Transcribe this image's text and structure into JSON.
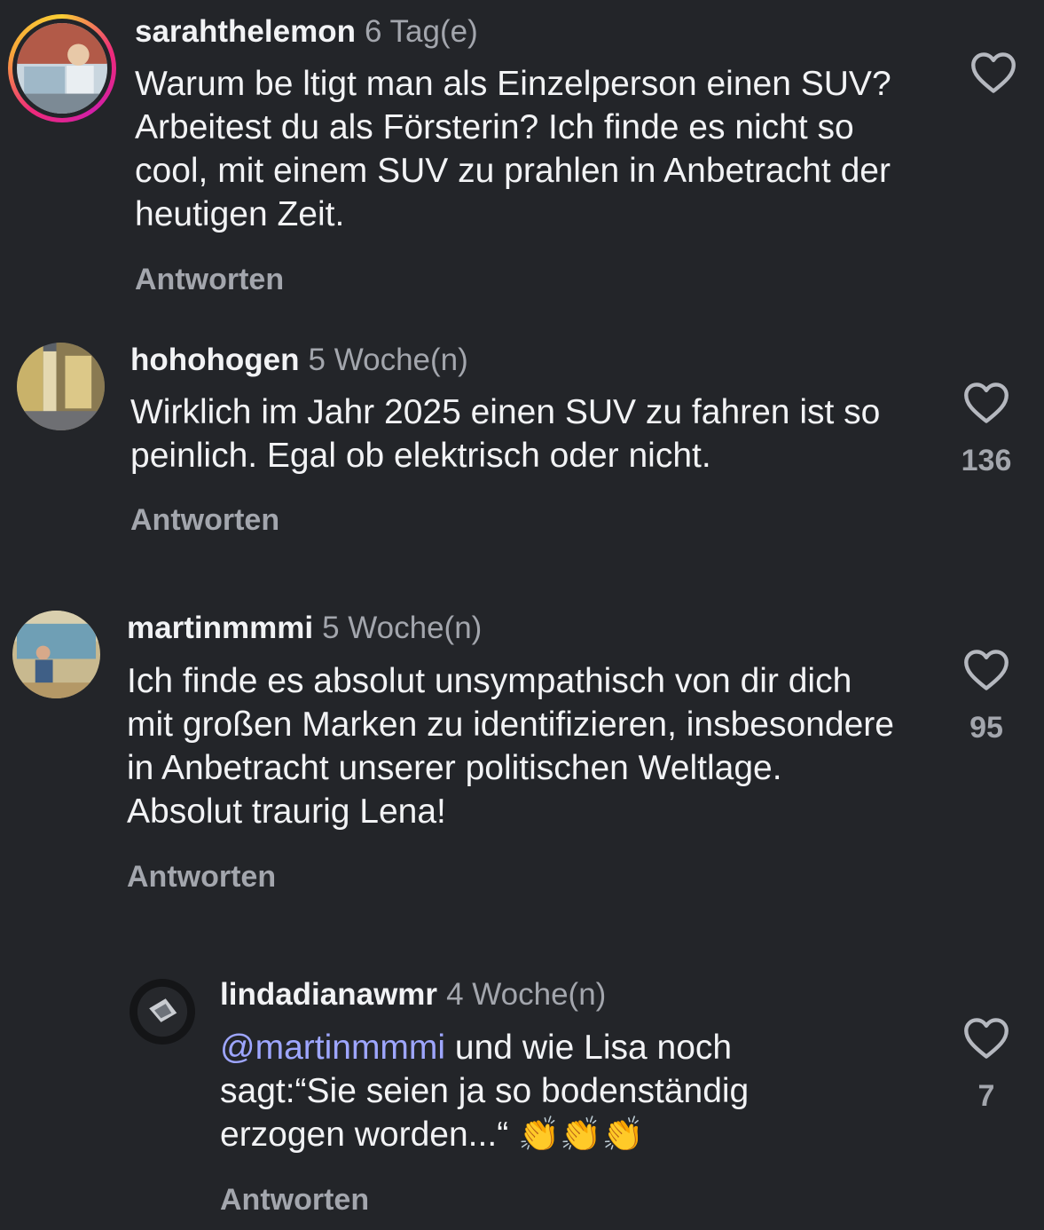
{
  "comments": [
    {
      "username": "sarahthelemon",
      "time": "6 Tag(e)",
      "text": "Warum be ltigt man als Einzelperson einen SUV? Arbeitest du als Försterin? Ich finde es nicht so cool, mit einem SUV zu prahlen in Anbetracht der heutigen Zeit.",
      "reply_label": "Antworten",
      "likes": "",
      "has_story": true
    },
    {
      "username": "hohohogen",
      "time": "5 Woche(n)",
      "text": "Wirklich im Jahr 2025 einen SUV zu fahren ist so peinlich. Egal ob elektrisch oder nicht.",
      "reply_label": "Antworten",
      "likes": "136",
      "has_story": false
    },
    {
      "username": "martinmmmi",
      "time": "5 Woche(n)",
      "text": "Ich finde es absolut unsympathisch von dir dich mit großen Marken zu identifizieren, insbesondere in Anbetracht unserer politischen Weltlage. Absolut traurig Lena!",
      "reply_label": "Antworten",
      "likes": "95",
      "has_story": false
    },
    {
      "username": "lindadianawmr",
      "time": "4 Woche(n)",
      "mention": "@martinmmmi",
      "text": " und wie Lisa noch sagt:“Sie seien ja so bodenständig erzogen worden...“",
      "emoji": "👏👏👏",
      "reply_label": "Antworten",
      "likes": "7",
      "has_story": false,
      "is_reply": true
    }
  ],
  "icons": {
    "like": "heart-outline-icon"
  },
  "colors": {
    "background": "#232529",
    "text": "#f2f3f5",
    "secondary": "#a3a6ad",
    "mention": "#9ea6ff"
  }
}
